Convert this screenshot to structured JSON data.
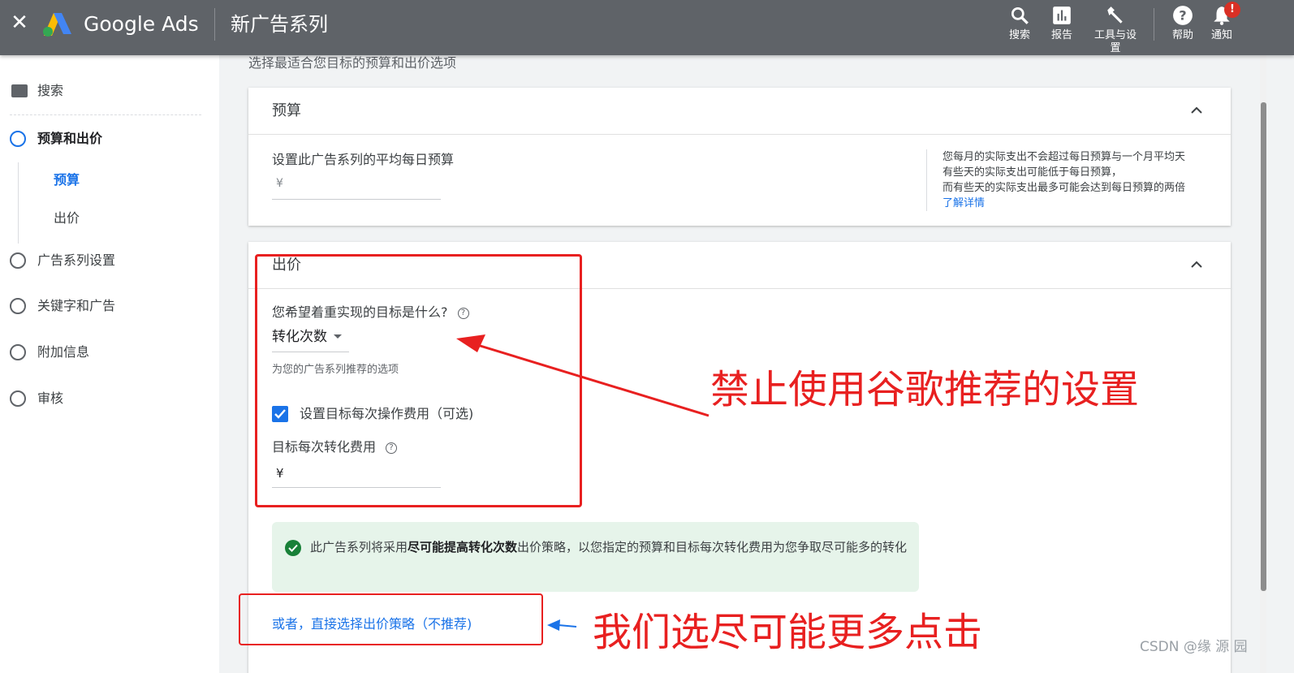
{
  "topbar": {
    "close_icon": "close-icon",
    "brand": "Google Ads",
    "title": "新广告系列",
    "tools": [
      {
        "label": "搜索",
        "icon": "search-icon"
      },
      {
        "label": "报告",
        "icon": "reports-icon"
      },
      {
        "label": "工具与设置",
        "icon": "wrench-icon"
      },
      {
        "label": "帮助",
        "icon": "help-icon"
      },
      {
        "label": "通知",
        "icon": "bell-icon"
      }
    ],
    "notification_badge": "!"
  },
  "sidebar": {
    "search_label": "搜索",
    "steps": [
      {
        "label": "预算和出价",
        "active": true
      },
      {
        "label": "广告系列设置",
        "active": false
      },
      {
        "label": "关键字和广告",
        "active": false
      },
      {
        "label": "附加信息",
        "active": false
      },
      {
        "label": "审核",
        "active": false
      }
    ],
    "substeps": [
      {
        "label": "预算",
        "active": true
      },
      {
        "label": "出价",
        "active": false
      }
    ]
  },
  "main": {
    "intro": "选择最适合您目标的预算和出价选项",
    "budget": {
      "heading": "预算",
      "question": "设置此广告系列的平均每日预算",
      "currency": "¥",
      "note_lines": [
        "您每月的实际支出不会超过每日预算与一个月平均天",
        "有些天的实际支出可能低于每日预算，",
        "而有些天的实际支出最多可能会达到每日预算的两倍"
      ],
      "learn_more": "了解详情"
    },
    "bidding": {
      "heading": "出价",
      "goal_question": "您希望着重实现的目标是什么?",
      "goal_value": "转化次数",
      "goal_hint": "为您的广告系列推荐的选项",
      "checkbox_label": "设置目标每次操作费用（可选)",
      "checkbox_checked": true,
      "cpa_label": "目标每次转化费用",
      "cpa_currency": "¥",
      "info_prefix": "此广告系列将采用",
      "info_strategy": "尽可能提高转化次数",
      "info_suffix": "出价策略，以您指定的预算和目标每次转化费用为您争取尽可能多的转化",
      "alt_link": "或者，直接选择出价策略（不推荐)"
    }
  },
  "annotations": {
    "text1": "禁止使用谷歌推荐的设置",
    "text2": "我们选尽可能更多点击",
    "color": "#e82020",
    "arrow2_color": "#1a73e8"
  },
  "watermark": "CSDN @缘  源  园",
  "colors": {
    "topbar": "#5f6368",
    "accent": "#1a73e8",
    "success": "#188038",
    "info_bg": "#e6f4ea"
  }
}
